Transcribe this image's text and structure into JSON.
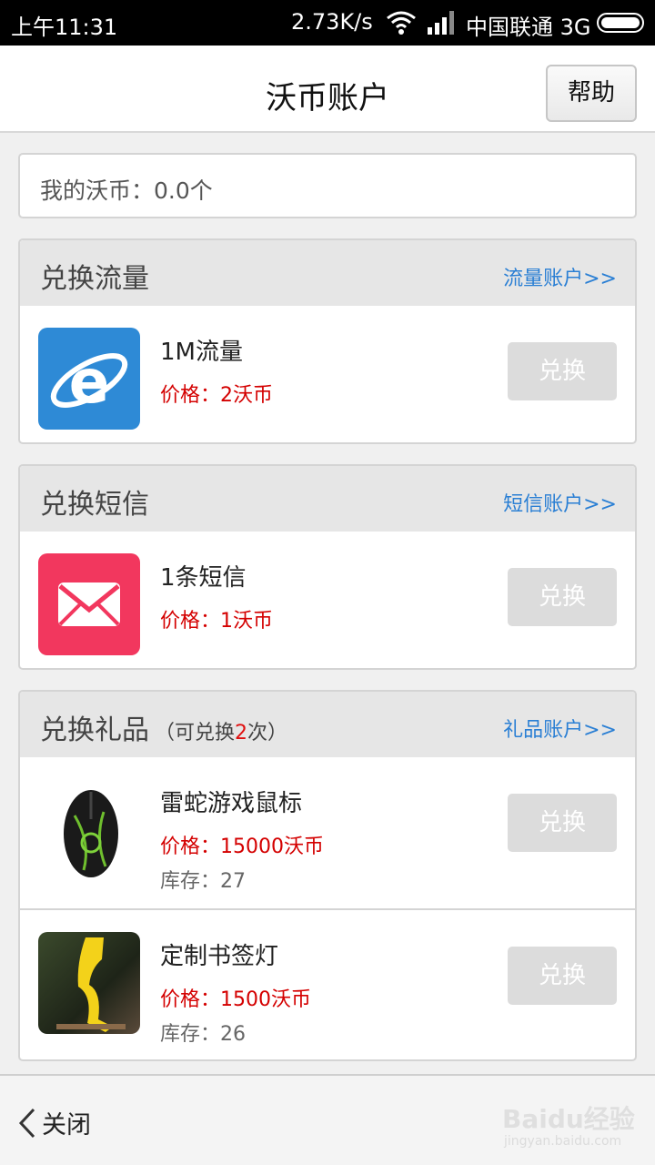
{
  "status_bar": {
    "time": "上午11:31",
    "speed": "2.73K/s",
    "carrier": "中国联通 3G",
    "icons": [
      "wifi-icon",
      "signal-icon",
      "battery-icon"
    ]
  },
  "header": {
    "title": "沃币账户",
    "help_label": "帮助"
  },
  "coins": {
    "text": "我的沃币：0.0个"
  },
  "sections": [
    {
      "title": "兑换流量",
      "link": "流量账户>>",
      "items": [
        {
          "name": "1M流量",
          "price": "价格：2沃币",
          "button": "兑换",
          "icon": "ie-browser-icon"
        }
      ]
    },
    {
      "title": "兑换短信",
      "link": "短信账户>>",
      "items": [
        {
          "name": "1条短信",
          "price": "价格：1沃币",
          "button": "兑换",
          "icon": "envelope-icon"
        }
      ]
    },
    {
      "title": "兑换礼品",
      "note_prefix": "（可兑换",
      "note_count": "2",
      "note_suffix": "次）",
      "link": "礼品账户>>",
      "items": [
        {
          "name": "雷蛇游戏鼠标",
          "price": "价格：15000沃币",
          "stock": "库存：27",
          "button": "兑换",
          "icon": "gaming-mouse-image"
        },
        {
          "name": "定制书签灯",
          "price": "价格：1500沃币",
          "stock": "库存：26",
          "button": "兑换",
          "icon": "bookmark-lamp-image"
        }
      ]
    }
  ],
  "footer": {
    "close_label": "关闭",
    "watermark_brand": "Baidu经验",
    "watermark_site": "jingyan.baidu.com"
  },
  "colors": {
    "price": "#d40000",
    "link": "#2a7fd4",
    "count_highlight": "#e01010",
    "button_disabled": "#dcdcdc",
    "ie_tile": "#2e8ad6",
    "mail_tile": "#f2375e"
  }
}
